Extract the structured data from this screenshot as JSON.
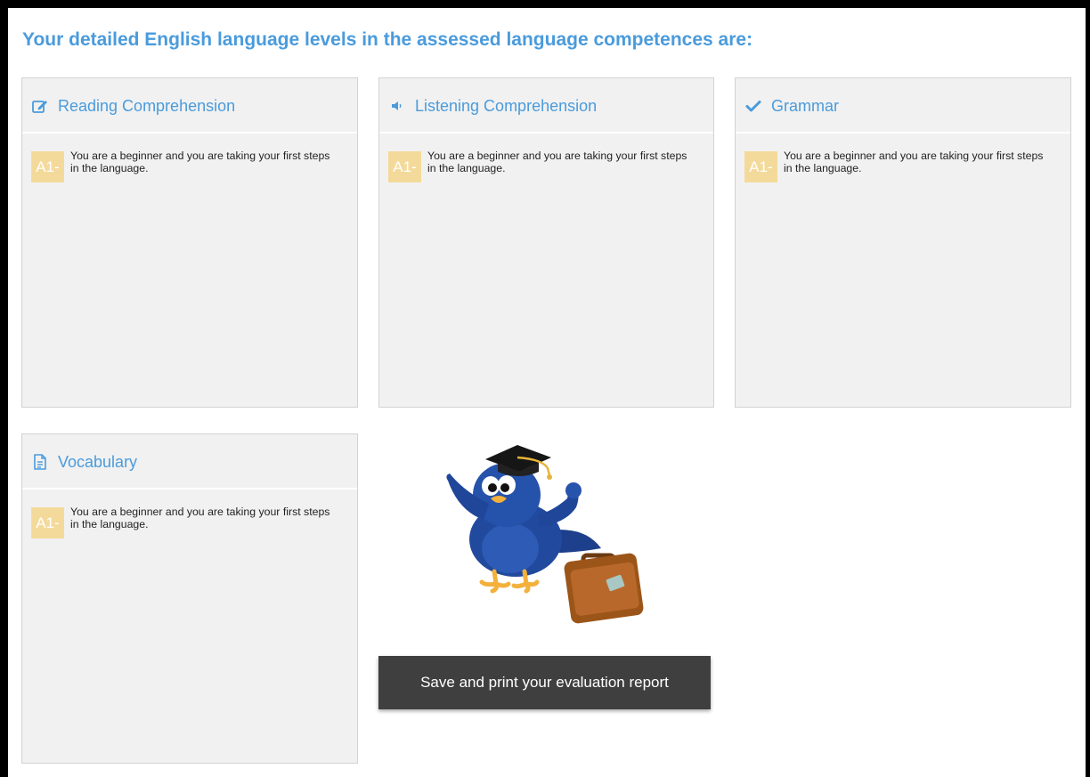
{
  "heading": "Your detailed English language levels in the assessed language competences are:",
  "cards": [
    {
      "title": "Reading Comprehension",
      "icon": "edit-icon",
      "level": "A1-",
      "description": "You are a beginner and you are taking your first steps in the language."
    },
    {
      "title": "Listening Comprehension",
      "icon": "speaker-icon",
      "level": "A1-",
      "description": "You are a beginner and you are taking your first steps in the language."
    },
    {
      "title": "Grammar",
      "icon": "checkmark-icon",
      "level": "A1-",
      "description": "You are a beginner and you are taking your first steps in the language."
    },
    {
      "title": "Vocabulary",
      "icon": "document-icon",
      "level": "A1-",
      "description": "You are a beginner and you are taking your first steps in the language."
    }
  ],
  "report_button": "Save and print your evaluation report",
  "colors": {
    "accent": "#4a9bdc",
    "badge": "#f4da9a",
    "card_bg": "#f1f1f1",
    "button_bg": "#3f3f3f"
  }
}
